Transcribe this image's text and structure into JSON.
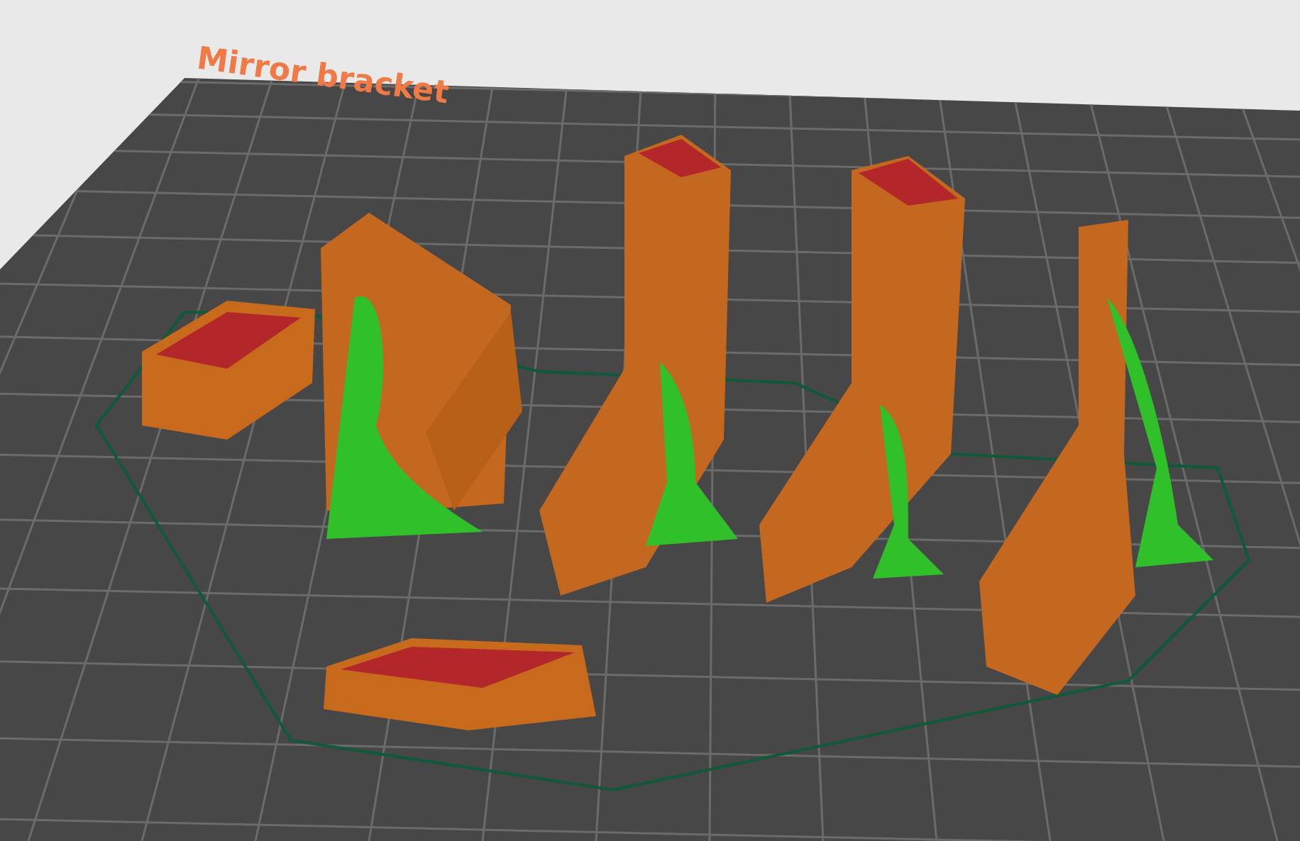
{
  "bed": {
    "title": "Mirror bracket"
  }
}
